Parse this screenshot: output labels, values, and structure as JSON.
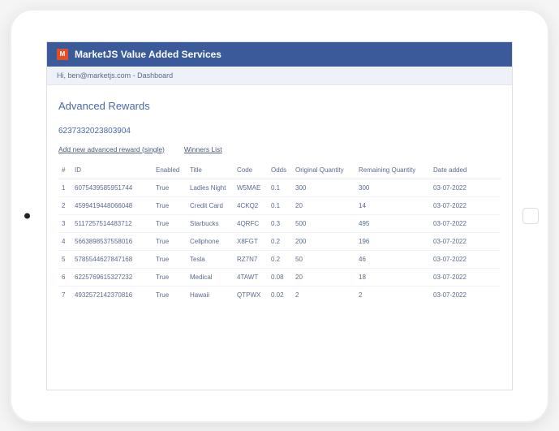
{
  "header": {
    "logo_letter": "M",
    "title": "MarketJS Value Added Services"
  },
  "subheader": {
    "greeting": "Hi, ben@marketjs.com - Dashboard"
  },
  "section": {
    "title": "Advanced Rewards",
    "campaign_id": "6237332023803904"
  },
  "actions": {
    "add_new": "Add new advanced reward (single)",
    "winners": "Winners List"
  },
  "table": {
    "headers": {
      "num": "#",
      "id": "ID",
      "enabled": "Enabled",
      "title": "Title",
      "code": "Code",
      "odds": "Odds",
      "oqty": "Original Quantity",
      "rqty": "Remaining Quantity",
      "date": "Date added"
    },
    "rows": [
      {
        "num": "1",
        "id": "6075439585951744",
        "enabled": "True",
        "title": "Ladies Night",
        "code": "W5MAE",
        "odds": "0.1",
        "oqty": "300",
        "rqty": "300",
        "date": "03-07-2022"
      },
      {
        "num": "2",
        "id": "4599419448066048",
        "enabled": "True",
        "title": "Credit Card",
        "code": "4CKQ2",
        "odds": "0.1",
        "oqty": "20",
        "rqty": "14",
        "date": "03-07-2022"
      },
      {
        "num": "3",
        "id": "5117257514483712",
        "enabled": "True",
        "title": "Starbucks",
        "code": "4QRFC",
        "odds": "0.3",
        "oqty": "500",
        "rqty": "495",
        "date": "03-07-2022"
      },
      {
        "num": "4",
        "id": "5663898537558016",
        "enabled": "True",
        "title": "Cellphone",
        "code": "X8FGT",
        "odds": "0.2",
        "oqty": "200",
        "rqty": "196",
        "date": "03-07-2022"
      },
      {
        "num": "5",
        "id": "5785544627847168",
        "enabled": "True",
        "title": "Tesla",
        "code": "RZ7N7",
        "odds": "0.2",
        "oqty": "50",
        "rqty": "46",
        "date": "03-07-2022"
      },
      {
        "num": "6",
        "id": "6225769615327232",
        "enabled": "True",
        "title": "Medical",
        "code": "4TAWT",
        "odds": "0.08",
        "oqty": "20",
        "rqty": "18",
        "date": "03-07-2022"
      },
      {
        "num": "7",
        "id": "4932572142370816",
        "enabled": "True",
        "title": "Hawaii",
        "code": "QTPWX",
        "odds": "0.02",
        "oqty": "2",
        "rqty": "2",
        "date": "03-07-2022"
      }
    ]
  }
}
